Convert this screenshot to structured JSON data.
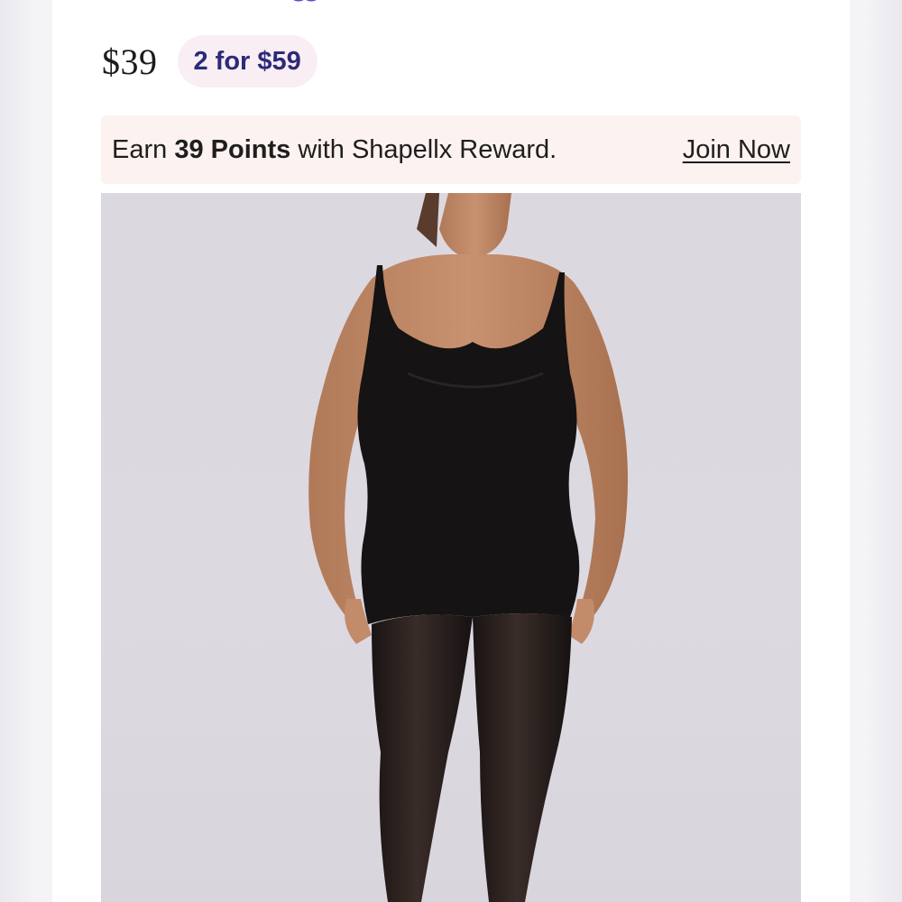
{
  "product": {
    "price": "$39",
    "promo_badge": "2 for $59",
    "image_icon": "product-photo-bodysuit"
  },
  "reward": {
    "prefix": "Earn ",
    "points": "39 Points",
    "suffix": " with Shapellx Reward.",
    "join_label": "Join Now"
  },
  "colors": {
    "badge_bg": "#f8eef3",
    "badge_text": "#2c2a7a",
    "banner_bg": "#fcf2ef",
    "image_bg": "#dcd8e0"
  }
}
